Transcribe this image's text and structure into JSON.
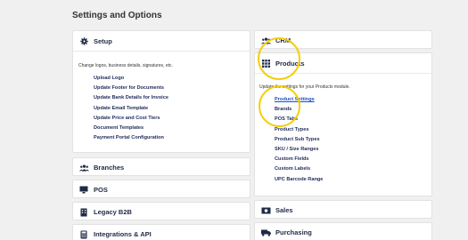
{
  "page_title": "Settings and Options",
  "left": {
    "setup": {
      "title": "Setup",
      "description": "Change logos, business details, signatures, etc.",
      "links": [
        "Upload Logo",
        "Update Footer for Documents",
        "Update Bank Details for Invoice",
        "Update Email Template",
        "Update Price and Cost Tiers",
        "Document Templates",
        "Payment Portal Configuration"
      ]
    },
    "branches": "Branches",
    "pos": "POS",
    "legacy_b2b": "Legacy B2B",
    "integrations": "Integrations & API"
  },
  "right": {
    "crm": "CRM",
    "products": {
      "title": "Products",
      "description": "Update the settings for your Products module.",
      "links": [
        "Product Settings",
        "Brands",
        "POS Tabs",
        "Product Types",
        "Product Sub Types",
        "SKU / Size Ranges",
        "Custom Fields",
        "Custom Labels",
        "UPC Barcode Range"
      ]
    },
    "sales": "Sales",
    "purchasing": "Purchasing"
  },
  "colors": {
    "highlight": "#f2cf0e",
    "text": "#1f2a44",
    "active_link": "#1a4fc7"
  }
}
